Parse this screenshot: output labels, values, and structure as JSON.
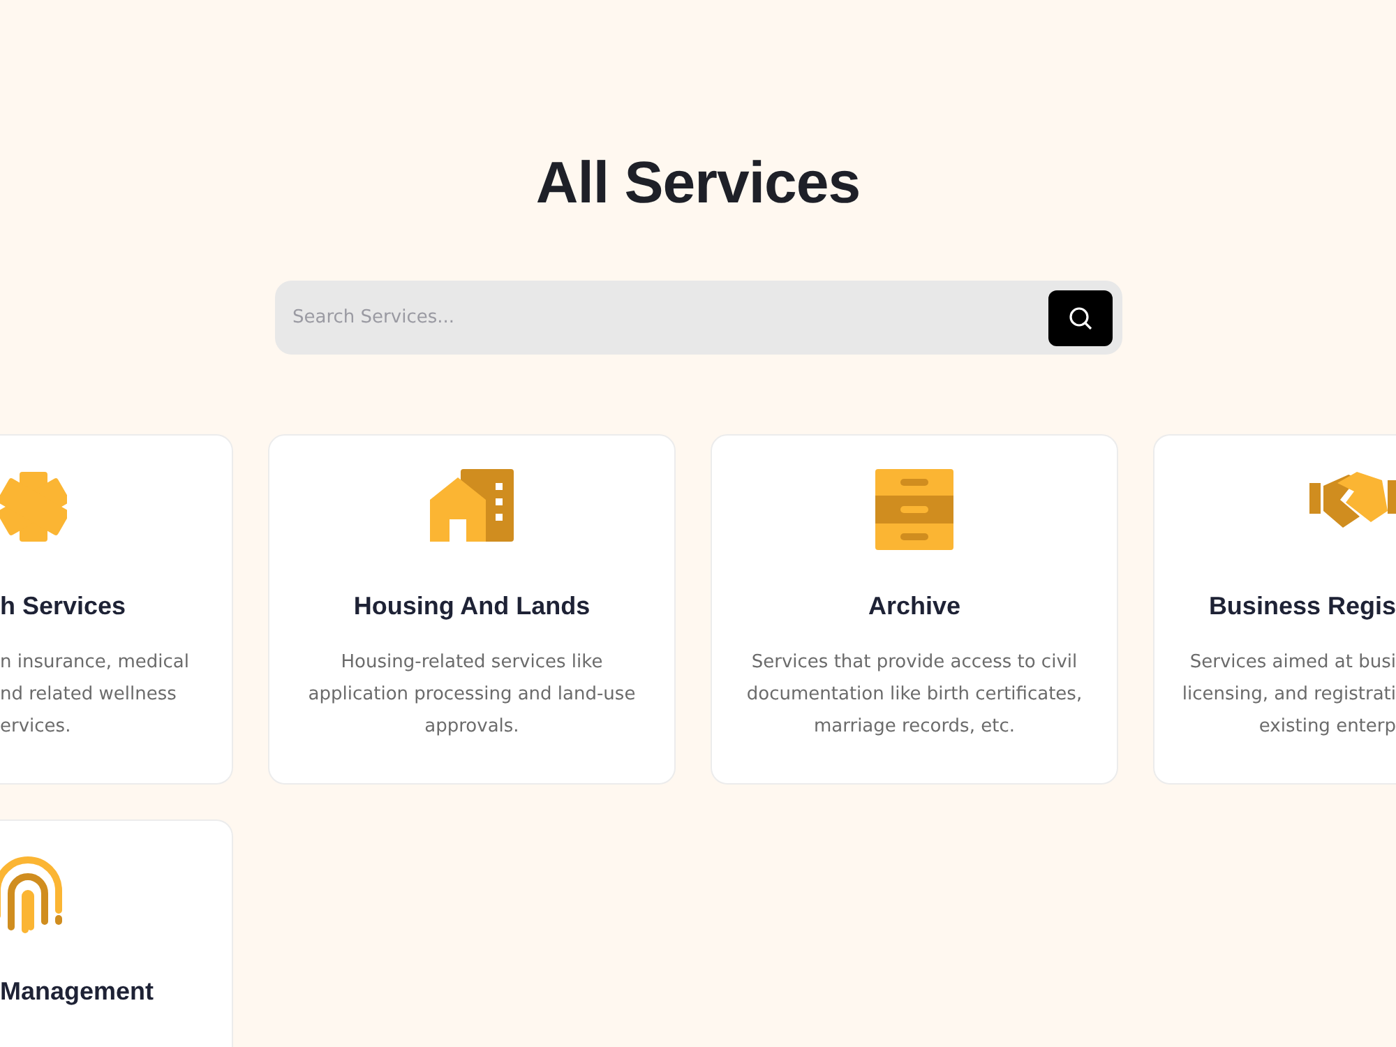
{
  "page": {
    "title": "All Services"
  },
  "search": {
    "placeholder": "Search Services..."
  },
  "services": [
    {
      "kind": "cut-left",
      "title": "h Services",
      "description": [
        "n insurance, medical",
        "nd related wellness",
        "ervices."
      ]
    },
    {
      "kind": "whole",
      "title": "Housing And Lands",
      "description": [
        "Housing-related services like",
        "application processing and land-use",
        "approvals."
      ]
    },
    {
      "kind": "whole",
      "title": "Archive",
      "description": [
        "Services that provide access to civil",
        "documentation like birth certificates,",
        "marriage records, etc."
      ]
    },
    {
      "kind": "cut-right",
      "title": "Business Regis",
      "description": [
        "Services aimed at busi",
        "licensing, and registrati",
        "existing enterp"
      ]
    },
    {
      "kind": "cut-left",
      "title": "Management"
    }
  ]
}
